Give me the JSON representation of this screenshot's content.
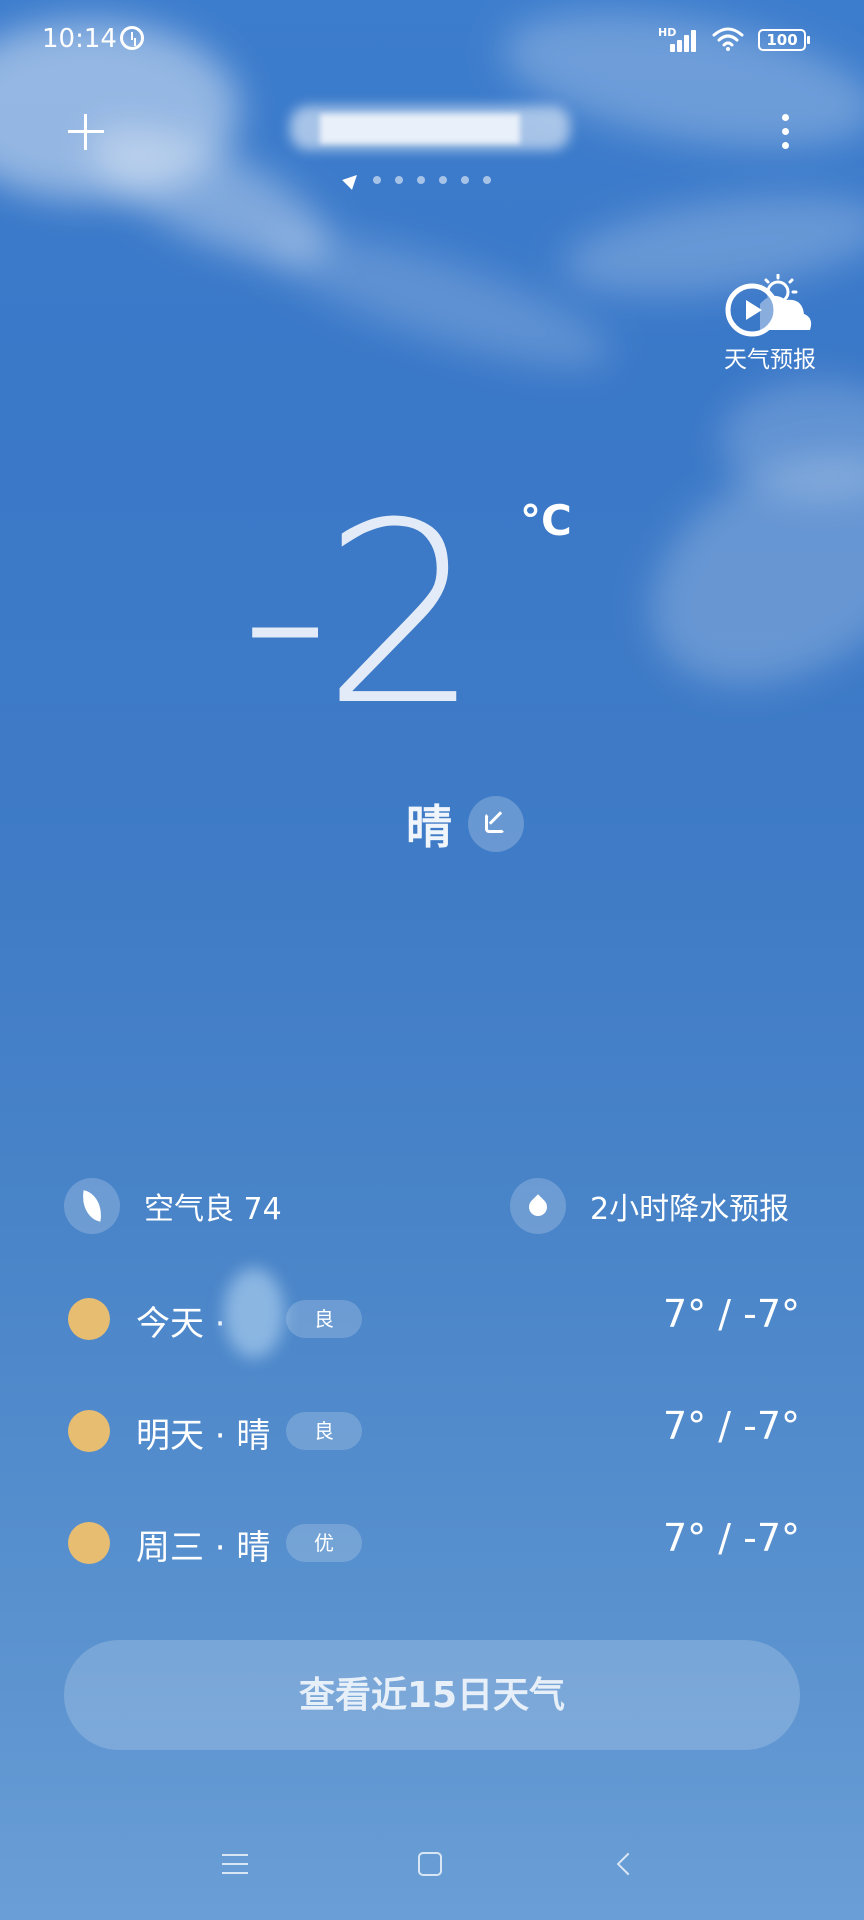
{
  "status_bar": {
    "time": "10:14",
    "network_label": "HD",
    "battery": "100",
    "icons": [
      "alarm-icon",
      "signal-icon",
      "wifi-icon",
      "battery-icon"
    ]
  },
  "header": {
    "city": "",
    "city_obscured": true,
    "page_count": 6,
    "icons": [
      "add-icon",
      "location-arrow-icon",
      "more-vertical-icon"
    ]
  },
  "forecast_video": {
    "label": "天气预报",
    "icon": "play-weather-icon"
  },
  "current": {
    "temperature": "-2",
    "unit": "°C",
    "condition": "晴",
    "edit_icon": "edit-icon"
  },
  "air_quality": {
    "label": "空气良 74",
    "icon": "leaf-icon"
  },
  "rain_forecast": {
    "label": "2小时降水预报",
    "icon": "water-drop-icon"
  },
  "days": [
    {
      "name": "今天 ·",
      "aqi": "良",
      "temp": "7° / -7°",
      "icon": "sun-icon"
    },
    {
      "name": "明天 · 晴",
      "aqi": "良",
      "temp": "7° / -7°",
      "icon": "sun-icon"
    },
    {
      "name": "周三 · 晴",
      "aqi": "优",
      "temp": "7° / -7°",
      "icon": "sun-icon"
    }
  ],
  "fifteen_day_button": "查看近15日天气",
  "nav": {
    "icons": [
      "menu-icon",
      "home-icon",
      "back-icon"
    ]
  },
  "colors": {
    "sky_top": "#3d7dcd",
    "sky_bottom": "#6a9ed6",
    "sun": "#e7bd72"
  }
}
